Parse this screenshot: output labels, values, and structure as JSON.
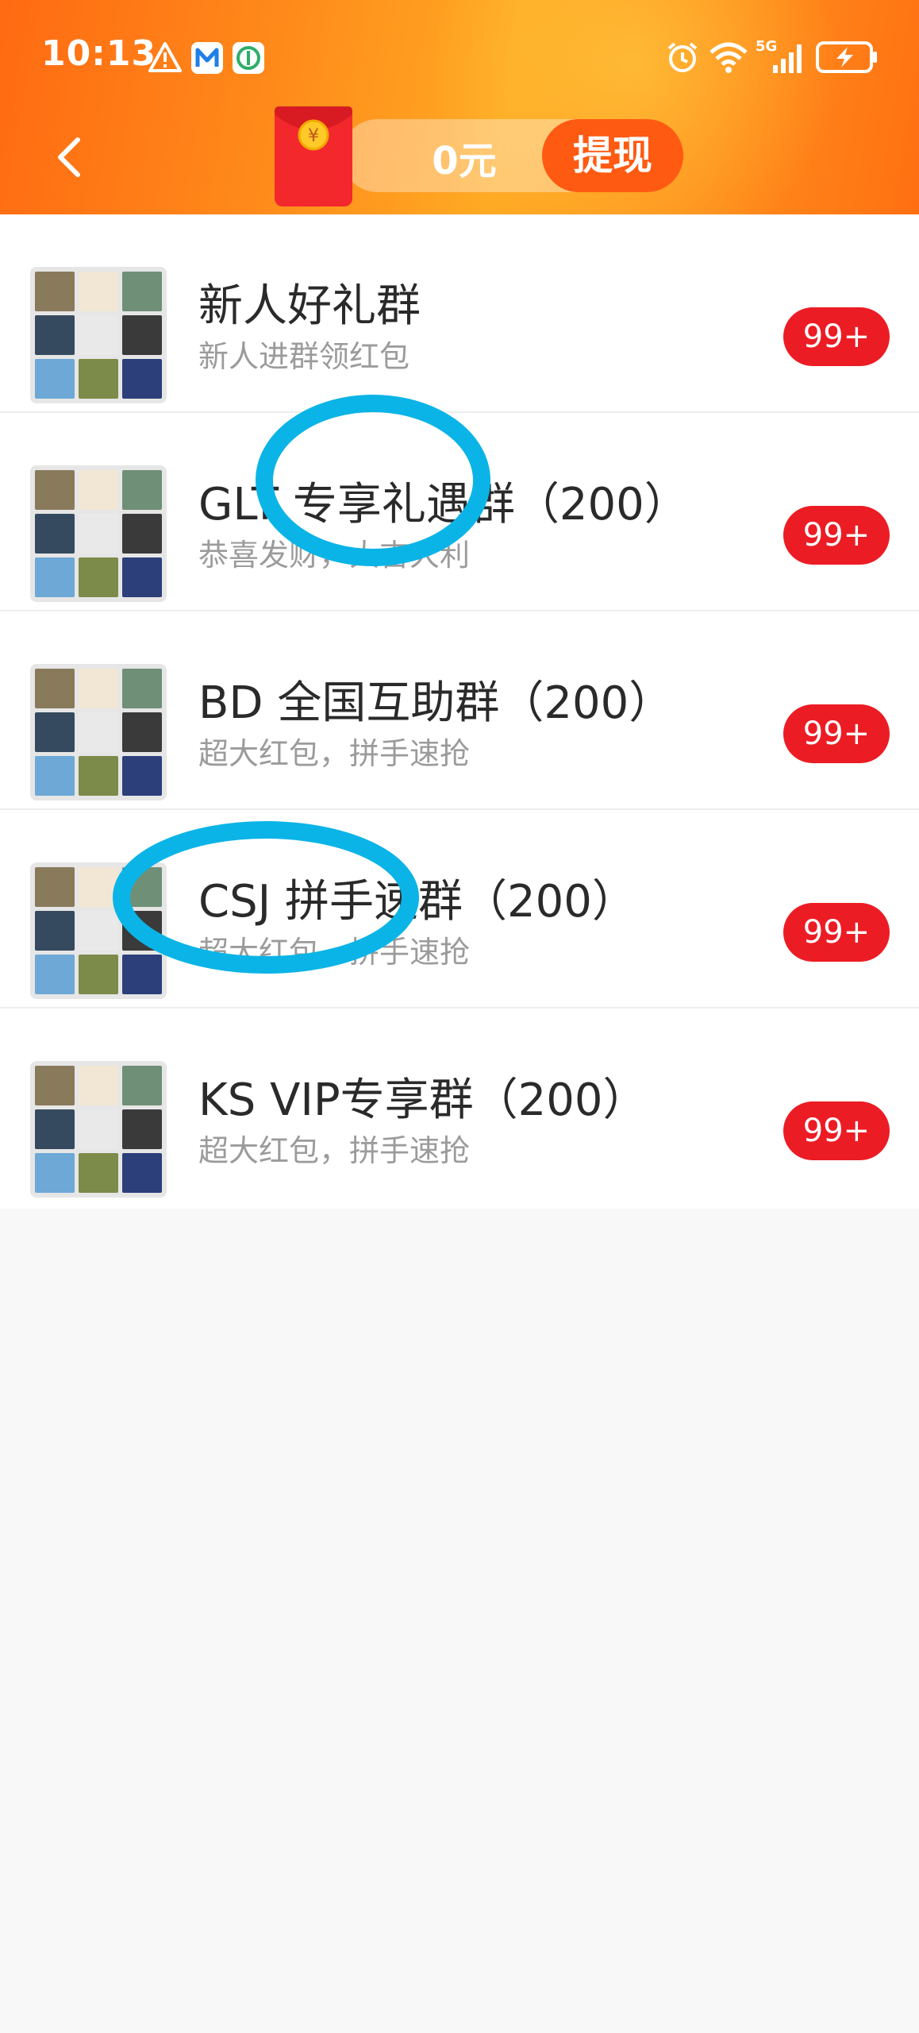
{
  "status_bar": {
    "time": "10:13",
    "icons": [
      "warning-icon",
      "m-app-icon",
      "app-icon",
      "alarm-icon",
      "wifi-icon",
      "5g-signal-icon",
      "battery-charging-icon"
    ],
    "network_label": "5G"
  },
  "header": {
    "balance": "0元",
    "withdraw_label": "提现",
    "back_icon": "chevron-left-icon",
    "packet_icon": "red-packet-icon",
    "packet_symbol": "¥"
  },
  "groups": [
    {
      "name": "新人好礼群",
      "subtitle": "新人进群领红包",
      "badge": "99+"
    },
    {
      "name": "GLT 专享礼遇群（200）",
      "subtitle": "恭喜发财，大吉大利",
      "badge": "99+"
    },
    {
      "name": "BD 全国互助群（200）",
      "subtitle": "超大红包，拼手速抢",
      "badge": "99+"
    },
    {
      "name": "CSJ 拼手速群（200）",
      "subtitle": "超大红包，拼手速抢",
      "badge": "99+"
    },
    {
      "name": "KS VIP专享群（200）",
      "subtitle": "超大红包，拼手速抢",
      "badge": "99+"
    }
  ],
  "colors": {
    "header_orange": "#ff7a16",
    "badge_red": "#ec1c24",
    "annotation_blue": "#0bb4e6",
    "withdraw_orange": "#ff5a12"
  },
  "avatar_tiles": [
    "#8a7a5c",
    "#f2e6d4",
    "#6f8f76",
    "#354a5e",
    "#e9e9e9",
    "#3a3a3a",
    "#6da8d6",
    "#7c8a4a",
    "#2c3f7a"
  ]
}
